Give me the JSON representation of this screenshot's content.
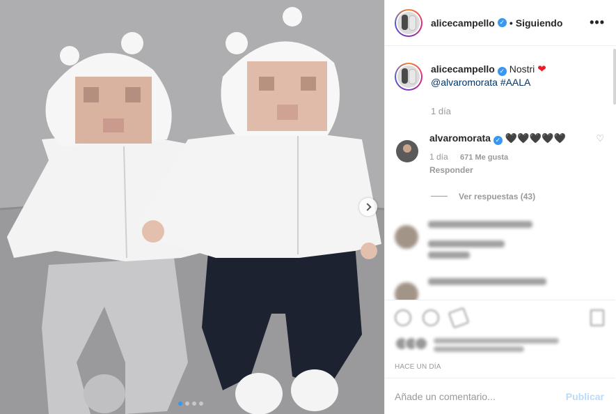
{
  "post": {
    "author": "alicecampello",
    "separator": "•",
    "follow_status": "Siguiendo",
    "more_icon": "more-horizontal-icon",
    "verified_icon": "verified-badge-icon"
  },
  "caption": {
    "username": "alicecampello",
    "text": "Nostri",
    "emoji": "❤",
    "mention": "@alvaromorata",
    "hashtag": "#AALA",
    "age": "1 día"
  },
  "comments": [
    {
      "username": "alvaromorata",
      "text": "🖤🖤🖤🖤🖤",
      "age": "1 día",
      "likes": "671 Me gusta",
      "reply_label": "Responder",
      "view_replies": "Ver respuestas (43)"
    }
  ],
  "footer": {
    "timestamp": "Hace un día",
    "comment_placeholder": "Añade un comentario...",
    "publish_label": "Publicar"
  },
  "carousel": {
    "slides": 4,
    "active_slide": 1
  },
  "colors": {
    "accent": "#3897f0",
    "text": "#262626",
    "muted": "#999999",
    "heart": "#ed1c24"
  }
}
